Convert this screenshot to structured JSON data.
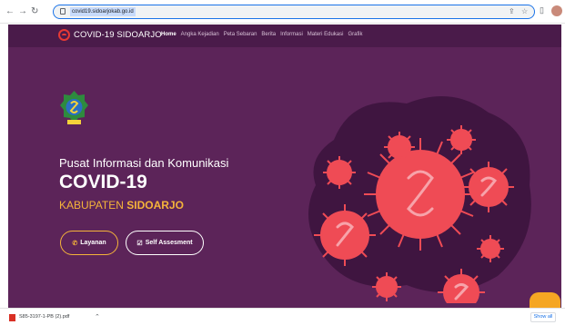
{
  "browser": {
    "url": "covid19.sidoarjokab.go.id"
  },
  "site": {
    "brand": "COVID-19 SIDOARJO",
    "menu": [
      "Home",
      "Angka Kejadian",
      "Peta Sebaran",
      "Berita",
      "Informasi",
      "Materi Edukasi",
      "Grafik"
    ],
    "active_menu": "Home"
  },
  "hero": {
    "subtitle": "Pusat Informasi dan Komunikasi",
    "title": "COVID-19",
    "region_prefix": "KABUPATEN",
    "region_name": "SIDOARJO",
    "buttons": {
      "layanan": "Layanan",
      "self": "Self Assesment"
    }
  },
  "downloads": {
    "file": "S85-3197-1-PB (2).pdf",
    "show_all": "Show all"
  },
  "colors": {
    "site_bg": "#5c2459",
    "nav_bg": "#4a1b4a",
    "accent": "#f5b43a",
    "virus": "#ef4b55",
    "scroll_top": "#f5a623"
  },
  "icons": {
    "back": "arrow-left-icon",
    "forward": "arrow-right-icon",
    "reload": "reload-icon",
    "lock": "lock-icon",
    "share": "share-icon",
    "bookmark": "star-icon",
    "sidebar": "sidebar-icon",
    "scroll_top": "chevron-up-icon",
    "layanan": "phone-icon",
    "self": "checkbox-icon"
  }
}
